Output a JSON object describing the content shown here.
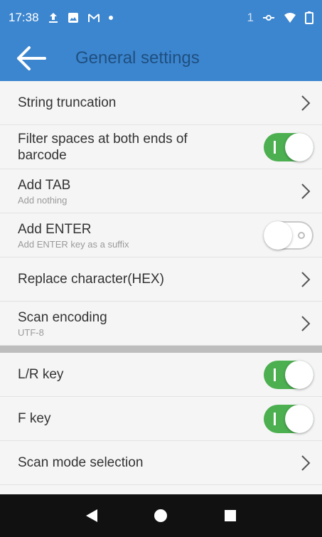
{
  "status_bar": {
    "time": "17:38",
    "notification_count": "1",
    "icons": [
      "upload-icon",
      "image-icon",
      "gmail-icon",
      "dot-icon",
      "wifi-calling-icon",
      "wifi-icon",
      "battery-icon"
    ]
  },
  "app_bar": {
    "title": "General settings",
    "back_icon": "arrow-left-icon",
    "background": "#3c86cf"
  },
  "settings": {
    "string_truncation": {
      "title": "String truncation"
    },
    "filter_spaces": {
      "title": "Filter spaces at both ends of barcode",
      "enabled": true
    },
    "add_tab": {
      "title": "Add TAB",
      "subtitle": "Add nothing"
    },
    "add_enter": {
      "title": "Add ENTER",
      "subtitle": "Add ENTER key as a suffix",
      "enabled": false
    },
    "replace_character": {
      "title": "Replace character(HEX)"
    },
    "scan_encoding": {
      "title": "Scan encoding",
      "subtitle": "UTF-8"
    },
    "lr_key": {
      "title": "L/R key",
      "enabled": true
    },
    "f_key": {
      "title": "F key",
      "enabled": true
    },
    "scan_mode_selection": {
      "title": "Scan mode selection"
    }
  },
  "colors": {
    "toggle_on": "#4caf50",
    "divider": "#bdbdbd",
    "nav_bar": "#111111"
  },
  "nav_bar": {
    "buttons": [
      "back-triangle-icon",
      "home-circle-icon",
      "recents-square-icon"
    ]
  }
}
